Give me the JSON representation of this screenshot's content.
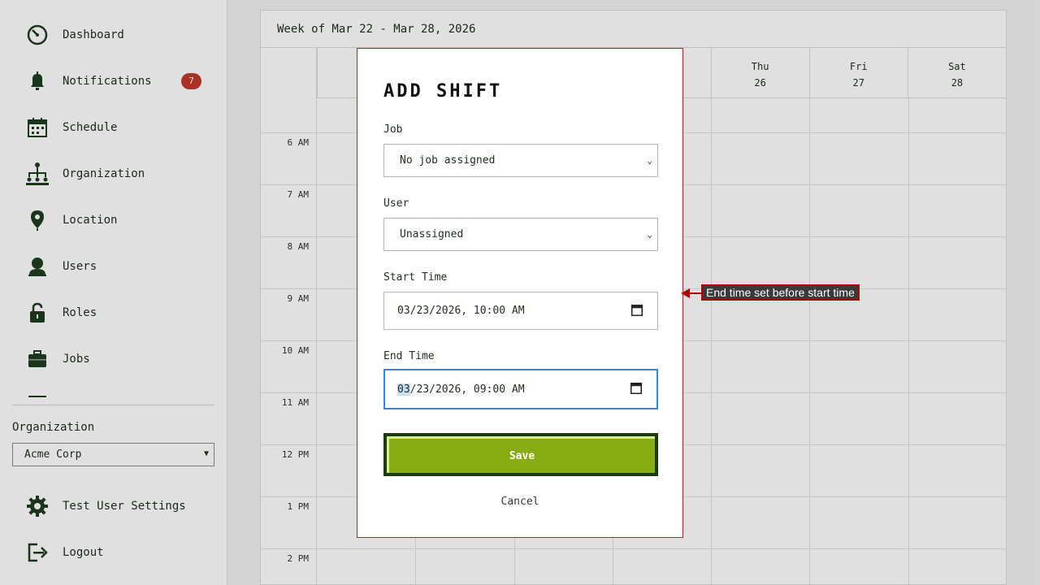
{
  "sidebar": {
    "items": [
      {
        "label": "Dashboard",
        "icon": "dashboard-icon"
      },
      {
        "label": "Notifications",
        "icon": "bell-icon",
        "badge": "7"
      },
      {
        "label": "Schedule",
        "icon": "calendar-icon"
      },
      {
        "label": "Organization",
        "icon": "org-chart-icon"
      },
      {
        "label": "Location",
        "icon": "map-pin-icon"
      },
      {
        "label": "Users",
        "icon": "user-icon"
      },
      {
        "label": "Roles",
        "icon": "lock-icon"
      },
      {
        "label": "Jobs",
        "icon": "briefcase-icon"
      }
    ],
    "org_label": "Organization",
    "org_value": "Acme Corp",
    "settings_label": "Test User Settings",
    "logout_label": "Logout"
  },
  "calendar": {
    "week_title": "Week of Mar 22 - Mar 28, 2026",
    "days": [
      {
        "name": "",
        "date": ""
      },
      {
        "name": "",
        "date": ""
      },
      {
        "name": "",
        "date": ""
      },
      {
        "name": "",
        "date": ""
      },
      {
        "name": "Thu",
        "date": "26"
      },
      {
        "name": "Fri",
        "date": "27"
      },
      {
        "name": "Sat",
        "date": "28"
      }
    ],
    "hours": [
      "6 AM",
      "7 AM",
      "8 AM",
      "9 AM",
      "10 AM",
      "11 AM",
      "12 PM",
      "1 PM",
      "2 PM"
    ]
  },
  "modal": {
    "title": "ADD SHIFT",
    "job_label": "Job",
    "job_value": "No job assigned",
    "user_label": "User",
    "user_value": "Unassigned",
    "start_label": "Start Time",
    "start_value": "03/23/2026, 10:00 AM",
    "end_label": "End Time",
    "end_value_month": "03",
    "end_value_rest": "/23/2026, 09:00 AM",
    "save_label": "Save",
    "cancel_label": "Cancel"
  },
  "annotation": {
    "text": "End time set before start time",
    "color": "#b00000"
  },
  "colors": {
    "accent_green": "#88ad10",
    "dark_green": "#1b3a0e",
    "badge_red": "#c0392b",
    "focus_blue": "#3b82d6"
  }
}
